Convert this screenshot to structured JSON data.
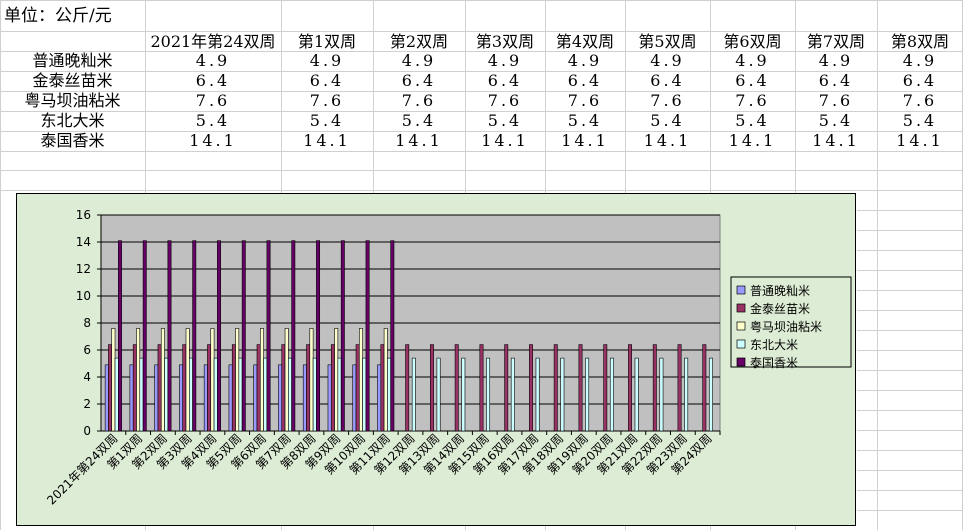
{
  "sheet": {
    "unit_label": "单位：公斤/元",
    "columns": [
      "2021年第24双周",
      "第1双周",
      "第2双周",
      "第3双周",
      "第4双周",
      "第5双周",
      "第6双周",
      "第7双周",
      "第8双周"
    ],
    "rows": [
      {
        "name": "普通晚籼米",
        "values": [
          "4.9",
          "4.9",
          "4.9",
          "4.9",
          "4.9",
          "4.9",
          "4.9",
          "4.9",
          "4.9"
        ]
      },
      {
        "name": "金泰丝苗米",
        "values": [
          "6.4",
          "6.4",
          "6.4",
          "6.4",
          "6.4",
          "6.4",
          "6.4",
          "6.4",
          "6.4"
        ]
      },
      {
        "name": "粤马坝油粘米",
        "values": [
          "7.6",
          "7.6",
          "7.6",
          "7.6",
          "7.6",
          "7.6",
          "7.6",
          "7.6",
          "7.6"
        ]
      },
      {
        "name": "东北大米",
        "values": [
          "5.4",
          "5.4",
          "5.4",
          "5.4",
          "5.4",
          "5.4",
          "5.4",
          "5.4",
          "5.4"
        ]
      },
      {
        "name": "泰国香米",
        "values": [
          "14.1",
          "14.1",
          "14.1",
          "14.1",
          "14.1",
          "14.1",
          "14.1",
          "14.1",
          "14.1"
        ]
      }
    ]
  },
  "chart_data": {
    "type": "bar",
    "ylim": [
      0,
      16
    ],
    "yticks": [
      0,
      2,
      4,
      6,
      8,
      10,
      12,
      14,
      16
    ],
    "grid": true,
    "legend_position": "right",
    "categories": [
      "2021年第24双周",
      "第1双周",
      "第2双周",
      "第3双周",
      "第4双周",
      "第5双周",
      "第6双周",
      "第7双周",
      "第8双周",
      "第9双周",
      "第10双周",
      "第11双周",
      "第12双周",
      "第13双周",
      "第14双周",
      "第15双周",
      "第16双周",
      "第17双周",
      "第18双周",
      "第19双周",
      "第20双周",
      "第21双周",
      "第22双周",
      "第23双周",
      "第24双周"
    ],
    "series": [
      {
        "name": "普通晚籼米",
        "color": "#9999ff",
        "values": [
          4.9,
          4.9,
          4.9,
          4.9,
          4.9,
          4.9,
          4.9,
          4.9,
          4.9,
          4.9,
          4.9,
          4.9,
          null,
          null,
          null,
          null,
          null,
          null,
          null,
          null,
          null,
          null,
          null,
          null,
          null
        ]
      },
      {
        "name": "金泰丝苗米",
        "color": "#993366",
        "values": [
          6.4,
          6.4,
          6.4,
          6.4,
          6.4,
          6.4,
          6.4,
          6.4,
          6.4,
          6.4,
          6.4,
          6.4,
          6.4,
          6.4,
          6.4,
          6.4,
          6.4,
          6.4,
          6.4,
          6.4,
          6.4,
          6.4,
          6.4,
          6.4,
          6.4
        ]
      },
      {
        "name": "粤马坝油粘米",
        "color": "#ffffcc",
        "values": [
          7.6,
          7.6,
          7.6,
          7.6,
          7.6,
          7.6,
          7.6,
          7.6,
          7.6,
          7.6,
          7.6,
          7.6,
          null,
          null,
          null,
          null,
          null,
          null,
          null,
          null,
          null,
          null,
          null,
          null,
          null
        ]
      },
      {
        "name": "东北大米",
        "color": "#ccffff",
        "values": [
          5.4,
          5.4,
          5.4,
          5.4,
          5.4,
          5.4,
          5.4,
          5.4,
          5.4,
          5.4,
          5.4,
          5.4,
          5.4,
          5.4,
          5.4,
          5.4,
          5.4,
          5.4,
          5.4,
          5.4,
          5.4,
          5.4,
          5.4,
          5.4,
          5.4
        ]
      },
      {
        "name": "泰国香米",
        "color": "#660066",
        "values": [
          14.1,
          14.1,
          14.1,
          14.1,
          14.1,
          14.1,
          14.1,
          14.1,
          14.1,
          14.1,
          14.1,
          14.1,
          null,
          null,
          null,
          null,
          null,
          null,
          null,
          null,
          null,
          null,
          null,
          null,
          null
        ]
      }
    ]
  }
}
